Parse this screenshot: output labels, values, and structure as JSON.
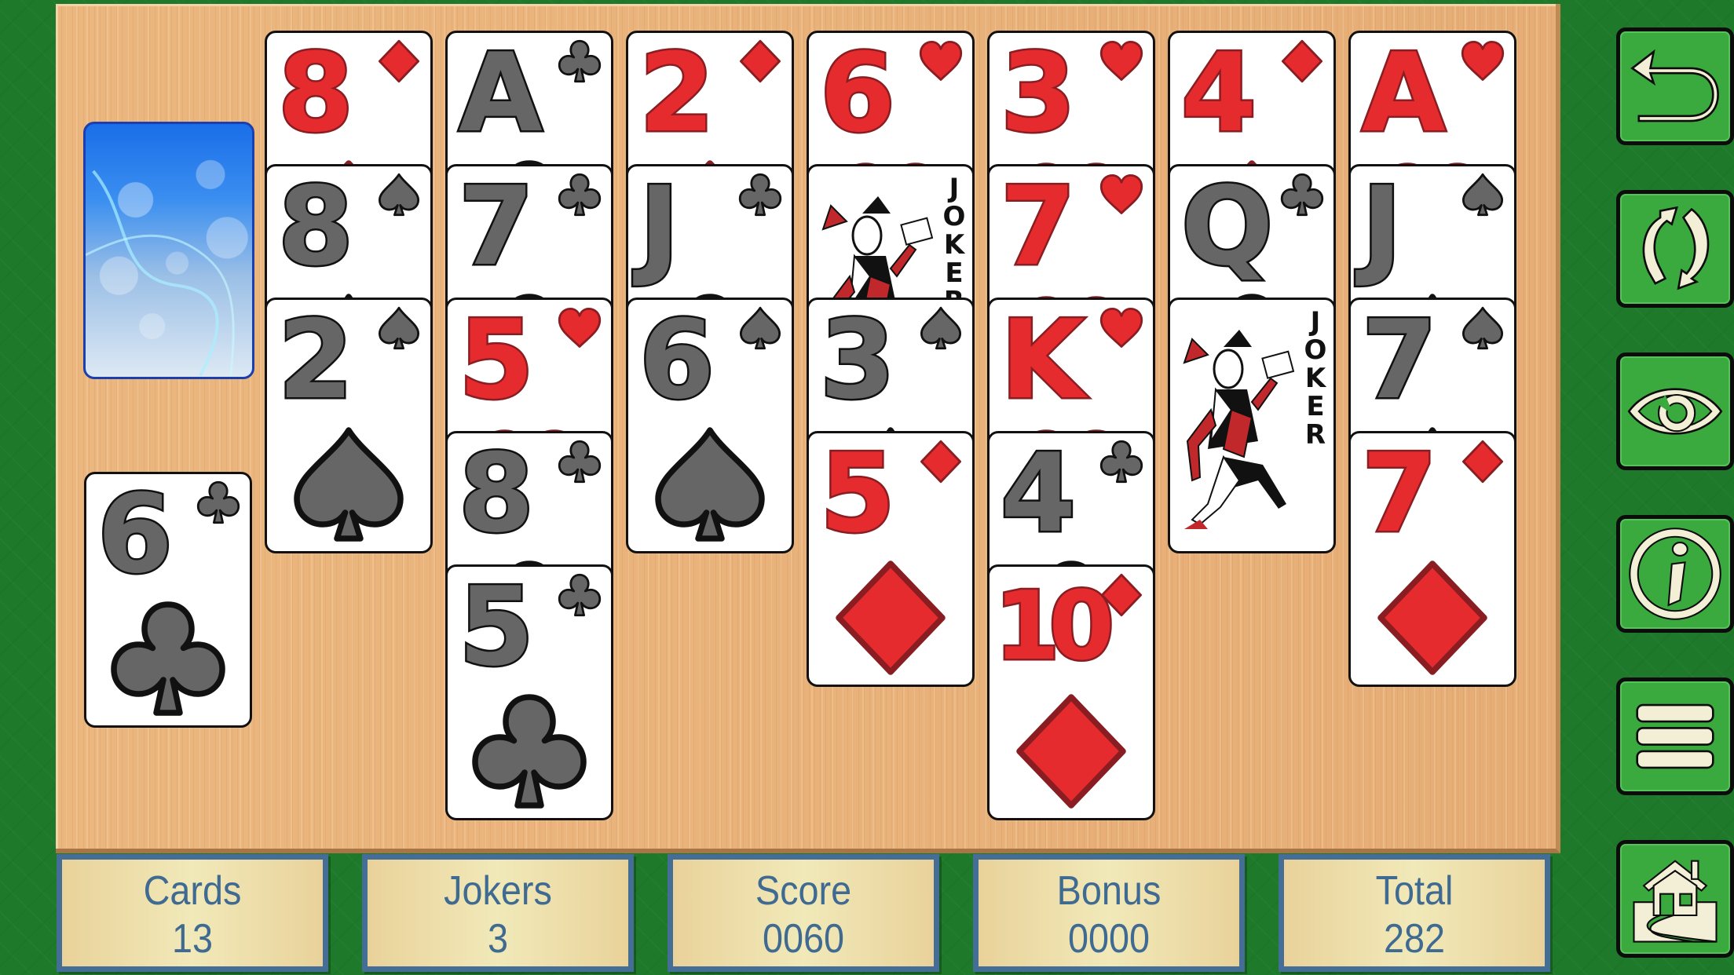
{
  "game": {
    "stock": {
      "label": "Stock pile (face down)"
    },
    "waste": {
      "rank": "6",
      "suit": "clubs"
    },
    "tableau": [
      [
        {
          "rank": "8",
          "suit": "diamonds"
        },
        {
          "rank": "8",
          "suit": "spades"
        },
        {
          "rank": "2",
          "suit": "spades"
        }
      ],
      [
        {
          "rank": "A",
          "suit": "clubs"
        },
        {
          "rank": "7",
          "suit": "clubs"
        },
        {
          "rank": "5",
          "suit": "hearts"
        },
        {
          "rank": "8",
          "suit": "clubs"
        },
        {
          "rank": "5",
          "suit": "clubs"
        }
      ],
      [
        {
          "rank": "2",
          "suit": "diamonds"
        },
        {
          "rank": "J",
          "suit": "clubs"
        },
        {
          "rank": "6",
          "suit": "spades"
        }
      ],
      [
        {
          "rank": "6",
          "suit": "hearts"
        },
        {
          "rank": "JOKER",
          "suit": "joker"
        },
        {
          "rank": "3",
          "suit": "spades"
        },
        {
          "rank": "5",
          "suit": "diamonds"
        }
      ],
      [
        {
          "rank": "3",
          "suit": "hearts"
        },
        {
          "rank": "7",
          "suit": "hearts"
        },
        {
          "rank": "K",
          "suit": "hearts"
        },
        {
          "rank": "4",
          "suit": "clubs"
        },
        {
          "rank": "10",
          "suit": "diamonds"
        }
      ],
      [
        {
          "rank": "4",
          "suit": "diamonds"
        },
        {
          "rank": "Q",
          "suit": "clubs"
        },
        {
          "rank": "JOKER",
          "suit": "joker"
        }
      ],
      [
        {
          "rank": "A",
          "suit": "hearts"
        },
        {
          "rank": "J",
          "suit": "spades"
        },
        {
          "rank": "7",
          "suit": "spades"
        },
        {
          "rank": "7",
          "suit": "diamonds"
        }
      ]
    ]
  },
  "side_buttons": [
    {
      "name": "undo-button",
      "icon": "undo-arrow-icon"
    },
    {
      "name": "restart-button",
      "icon": "refresh-icon"
    },
    {
      "name": "hint-button",
      "icon": "eye-icon"
    },
    {
      "name": "info-button",
      "icon": "info-icon"
    },
    {
      "name": "menu-button",
      "icon": "hamburger-menu-icon"
    },
    {
      "name": "home-button",
      "icon": "home-icon"
    }
  ],
  "stats": [
    {
      "label": "Cards",
      "value": "13"
    },
    {
      "label": "Jokers",
      "value": "3"
    },
    {
      "label": "Score",
      "value": "0060"
    },
    {
      "label": "Bonus",
      "value": "0000"
    },
    {
      "label": "Total",
      "value": "282"
    }
  ],
  "colors": {
    "felt": "#1e7a2a",
    "table_wood": "#e8b27a",
    "button_green": "#3aaa3f",
    "icon_cream": "#f3efd6",
    "red_suit": "#e62b2e",
    "black_suit": "#666666",
    "stat_text": "#3f6a92",
    "stat_border": "#456e96"
  }
}
